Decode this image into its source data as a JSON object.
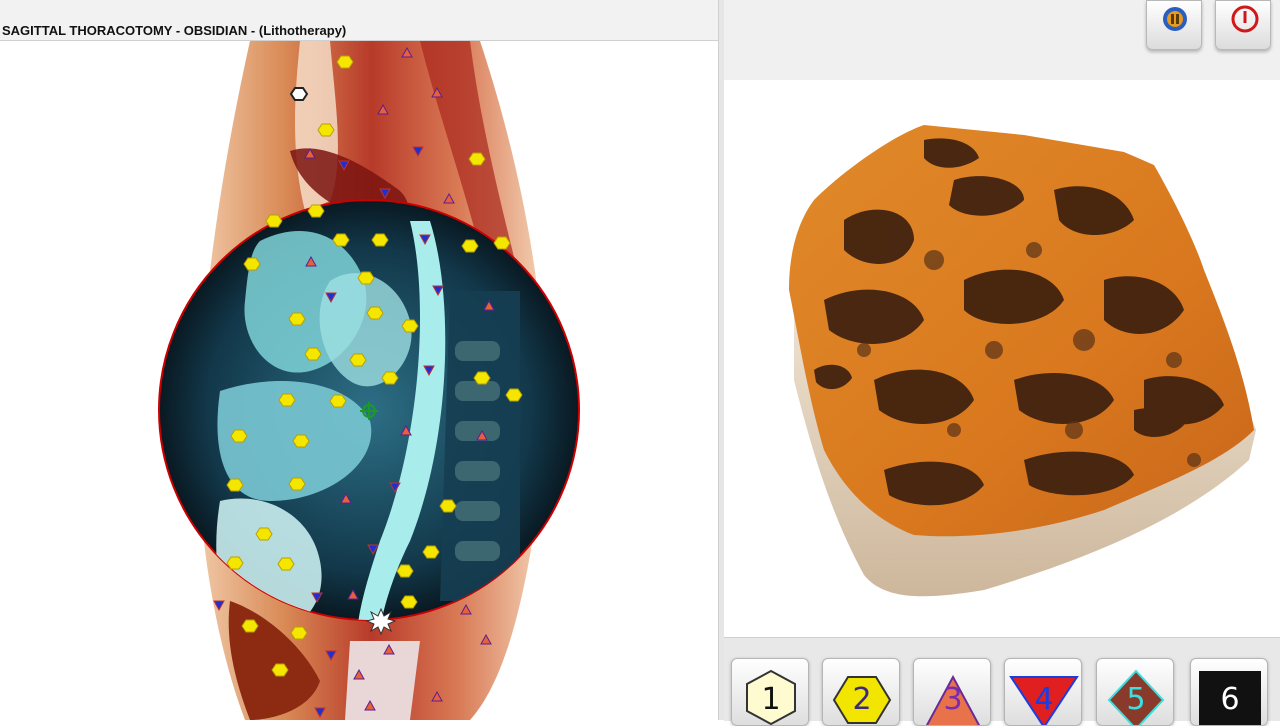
{
  "window": {
    "title": "SAGITTAL THORACOTOMY - OBSIDIAN - (Lithotherapy)"
  },
  "toolbar": {
    "buttons": [
      {
        "name": "audio-button",
        "icon": "speaker-icon"
      },
      {
        "name": "power-button",
        "icon": "power-icon"
      }
    ]
  },
  "mode_buttons": [
    {
      "label": "1",
      "icon": "hexagon-icon",
      "color": "#fffbd0",
      "text_color": "#111111"
    },
    {
      "label": "2",
      "icon": "hexagon-icon",
      "color": "#f2e600",
      "text_color": "#3a2a80"
    },
    {
      "label": "3",
      "icon": "triangle-up-icon",
      "color": "#e8734a",
      "text_color": "#7a2bb0"
    },
    {
      "label": "4",
      "icon": "triangle-down-icon",
      "color": "#e02020",
      "text_color": "#1a3de0"
    },
    {
      "label": "5",
      "icon": "diamond-icon",
      "color": "#8a3a2a",
      "text_color": "#3ae0e0"
    },
    {
      "label": "6",
      "icon": "square-icon",
      "color": "#111111",
      "text_color": "#ffffff"
    }
  ],
  "colors": {
    "marker_hexagon": "#f5e600",
    "marker_triangle_up": "#e8603a",
    "marker_triangle_down": "#2030d0",
    "lens_outline": "#cc0000",
    "stone_orange": "#d9781e",
    "stone_dark": "#3a1e0e"
  }
}
